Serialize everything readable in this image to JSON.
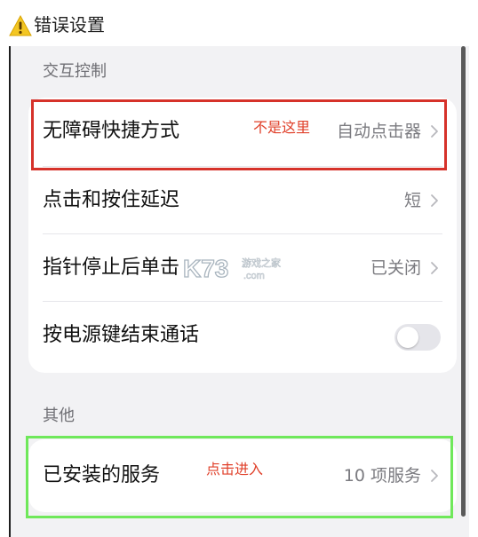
{
  "header": {
    "title": "错误设置",
    "icon": "warning-icon"
  },
  "sections": {
    "interaction": {
      "label": "交互控制",
      "rows": [
        {
          "label": "无障碍快捷方式",
          "value": "自动点击器"
        },
        {
          "label": "点击和按住延迟",
          "value": "短"
        },
        {
          "label": "指针停止后单击",
          "value": "已关闭"
        },
        {
          "label": "按电源键结束通话",
          "toggle_on": false
        }
      ]
    },
    "other": {
      "label": "其他",
      "rows": [
        {
          "label": "已安装的服务",
          "value": "10 项服务"
        }
      ]
    }
  },
  "annotations": {
    "wrong": {
      "text": "不是这里",
      "color": "#d6322a"
    },
    "correct": {
      "text": "点击进入",
      "color": "#6fe85a"
    }
  },
  "watermark": {
    "brand": "K73",
    "text": "游戏之家",
    "domain": ".com"
  },
  "colors": {
    "screen_bg": "#f2f2f4",
    "card_bg": "#ffffff",
    "annotation_text": "#e0402a"
  }
}
